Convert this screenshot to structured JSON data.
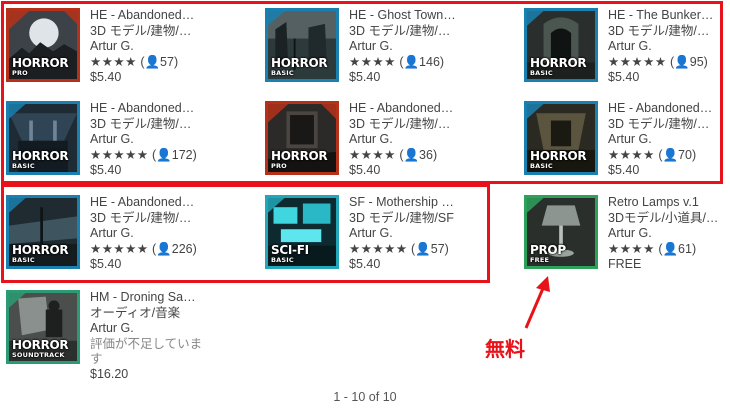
{
  "products": [
    {
      "title": "HE - Abandoned…",
      "category": "3D モデル/建物/…",
      "author": "Artur G.",
      "stars": "★★★★",
      "reviews": "(👤57)",
      "price": "$5.40",
      "badge": {
        "cat": "HORROR",
        "tier": "PRO"
      }
    },
    {
      "title": "HE - Ghost Town…",
      "category": "3D モデル/建物/…",
      "author": "Artur G.",
      "stars": "★★★★",
      "reviews": "(👤146)",
      "price": "$5.40",
      "badge": {
        "cat": "HORROR",
        "tier": "BASIC"
      }
    },
    {
      "title": "HE - The Bunker…",
      "category": "3D モデル/建物/…",
      "author": "Artur G.",
      "stars": "★★★★★",
      "reviews": "(👤95)",
      "price": "$5.40",
      "badge": {
        "cat": "HORROR",
        "tier": "BASIC"
      }
    },
    {
      "title": "HE - Abandoned…",
      "category": "3D モデル/建物/…",
      "author": "Artur G.",
      "stars": "★★★★★",
      "reviews": "(👤172)",
      "price": "$5.40",
      "badge": {
        "cat": "HORROR",
        "tier": "BASIC"
      }
    },
    {
      "title": "HE - Abandoned…",
      "category": "3D モデル/建物/…",
      "author": "Artur G.",
      "stars": "★★★★",
      "reviews": "(👤36)",
      "price": "$5.40",
      "badge": {
        "cat": "HORROR",
        "tier": "PRO"
      }
    },
    {
      "title": "HE - Abandoned…",
      "category": "3D モデル/建物/…",
      "author": "Artur G.",
      "stars": "★★★★",
      "reviews": "(👤70)",
      "price": "$5.40",
      "badge": {
        "cat": "HORROR",
        "tier": "BASIC"
      }
    },
    {
      "title": "HE - Abandoned…",
      "category": "3D モデル/建物/…",
      "author": "Artur G.",
      "stars": "★★★★★",
      "reviews": "(👤226)",
      "price": "$5.40",
      "badge": {
        "cat": "HORROR",
        "tier": "BASIC"
      }
    },
    {
      "title": "SF - Mothership …",
      "category": "3D モデル/建物/SF",
      "author": "Artur G.",
      "stars": "★★★★★",
      "reviews": "(👤57)",
      "price": "$5.40",
      "badge": {
        "cat": "SCI-FI",
        "tier": "BASIC"
      }
    },
    {
      "title": "Retro Lamps v.1",
      "category": "3Dモデル/小道具/…",
      "author": "Artur G.",
      "stars": "★★★★",
      "reviews": "(👤61)",
      "price": "FREE",
      "badge": {
        "cat": "PROP",
        "tier": "FREE"
      }
    },
    {
      "title": "HM - Droning Sa…",
      "category": "オーディオ/音楽",
      "author": "Artur G.",
      "no_rating": "評価が不足しています",
      "price": "$16.20",
      "badge": {
        "cat": "HORROR",
        "tier": "SOUNDTRACK"
      }
    }
  ],
  "annotation": {
    "label": "無料"
  },
  "pagination": {
    "text": "1 - 10 of 10"
  },
  "colors": {
    "highlight": "#e8131a",
    "tier_pro": "#b5311a",
    "tier_basic": "#1a80b0",
    "tier_scifi": "#22a6b8",
    "tier_free": "#2da05a"
  }
}
